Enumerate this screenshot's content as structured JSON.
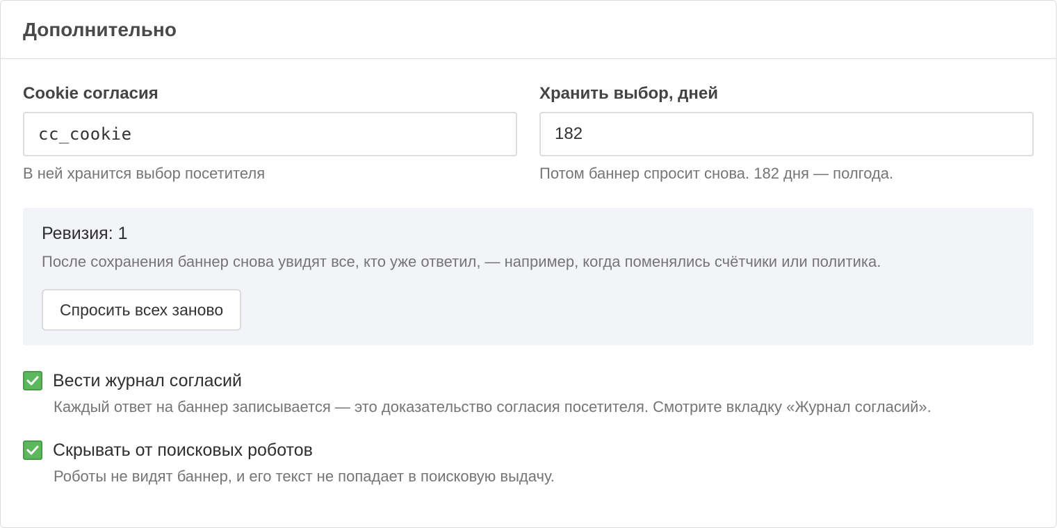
{
  "panel": {
    "title": "Дополнительно"
  },
  "fields": {
    "cookie": {
      "label": "Cookie согласия",
      "value": "cc_cookie",
      "hint": "В ней хранится выбор посетителя"
    },
    "days": {
      "label": "Хранить выбор, дней",
      "value": "182",
      "hint": "Потом баннер спросит снова. 182 дня — полгода."
    }
  },
  "revision": {
    "title": "Ревизия: 1",
    "description": "После сохранения баннер снова увидят все, кто уже ответил, — например, когда поменялись счётчики или политика.",
    "button_label": "Спросить всех заново"
  },
  "options": [
    {
      "label": "Вести журнал согласий",
      "checked": true,
      "hint": "Каждый ответ на баннер записывается — это доказательство согласия посетителя. Смотрите вкладку «Журнал согласий»."
    },
    {
      "label": "Скрывать от поисковых роботов",
      "checked": true,
      "hint": "Роботы не видят баннер, и его текст не попадает в поисковую выдачу."
    }
  ],
  "colors": {
    "checkbox_checked": "#5cb85c",
    "revision_background": "#f3f4f7",
    "hint_text": "#757575"
  },
  "icons": {
    "checkbox_mark": "check-icon"
  }
}
